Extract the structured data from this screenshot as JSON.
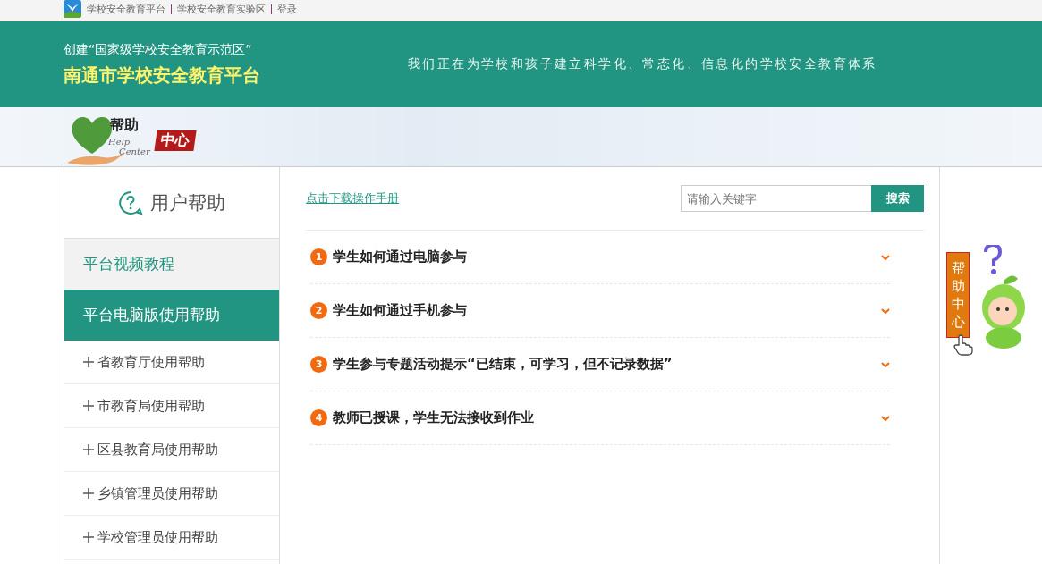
{
  "top_bar": {
    "links": [
      "学校安全教育平台",
      "学校安全教育实验区",
      "登录"
    ]
  },
  "header": {
    "subtitle": "创建“国家级学校安全教育示范区”",
    "title": "南通市学校安全教育平台",
    "slogan": "我们正在为学校和孩子建立科学化、常态化、信息化的学校安全教育体系"
  },
  "banner": {
    "logo_text_top": "帮助",
    "logo_text_en_1": "Help",
    "logo_text_en_2": "Center",
    "logo_badge": "中心"
  },
  "sidebar": {
    "title": "用户帮助",
    "items": [
      {
        "kind": "section",
        "label": "平台视频教程",
        "selected": false
      },
      {
        "kind": "section",
        "label": "平台电脑版使用帮助",
        "selected": true
      },
      {
        "kind": "sub",
        "label": "省教育厅使用帮助",
        "expanded": false
      },
      {
        "kind": "sub",
        "label": "市教育局使用帮助",
        "expanded": false
      },
      {
        "kind": "sub",
        "label": "区县教育局使用帮助",
        "expanded": false
      },
      {
        "kind": "sub",
        "label": "乡镇管理员使用帮助",
        "expanded": false
      },
      {
        "kind": "sub",
        "label": "学校管理员使用帮助",
        "expanded": false
      }
    ]
  },
  "content": {
    "download_link": "点击下载操作手册",
    "search": {
      "placeholder": "请输入关键字",
      "button": "搜索"
    },
    "faqs": [
      {
        "number": "1",
        "question": "学生如何通过电脑参与",
        "expanded": false
      },
      {
        "number": "2",
        "question": "学生如何通过手机参与",
        "expanded": false
      },
      {
        "number": "3",
        "question": "学生参与专题活动提示“已结束，可学习，但不记录数据”",
        "expanded": false
      },
      {
        "number": "4",
        "question": "教师已授课，学生无法接收到作业",
        "expanded": false
      }
    ]
  },
  "float_widget": {
    "chars": [
      "帮",
      "助",
      "中",
      "心"
    ]
  }
}
